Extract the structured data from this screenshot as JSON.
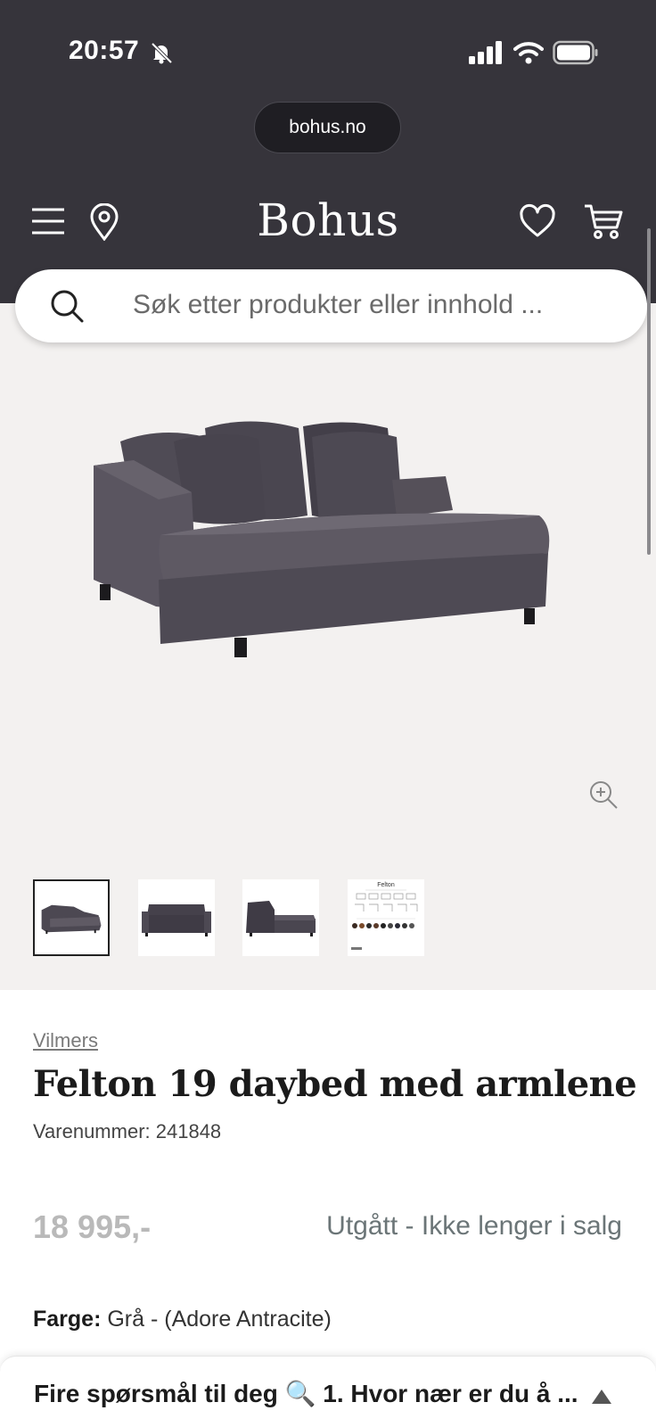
{
  "status_bar": {
    "time": "20:57"
  },
  "browser": {
    "url": "bohus.no"
  },
  "header": {
    "logo": "Bohus"
  },
  "search": {
    "placeholder": "Søk etter produkter eller innhold ..."
  },
  "gallery": {
    "thumbnails": [
      "Felton"
    ]
  },
  "product": {
    "brand": "Vilmers",
    "title": "Felton 19 daybed med armlene",
    "sku": "Varenummer: 241848",
    "price": "18 995,-",
    "availability": "Utgått - Ikke lenger i salg",
    "color_label": "Farge:",
    "color_value": "Grå - (Adore Antracite)"
  },
  "bottom_bar": {
    "text": "Fire spørsmål til deg 🔍 1. Hvor nær er du å ..."
  },
  "colors": {
    "header_bg": "#36343b",
    "gallery_bg": "#f3f1f0",
    "availability": "#6b7577",
    "price_disabled": "#b9b9b9"
  }
}
